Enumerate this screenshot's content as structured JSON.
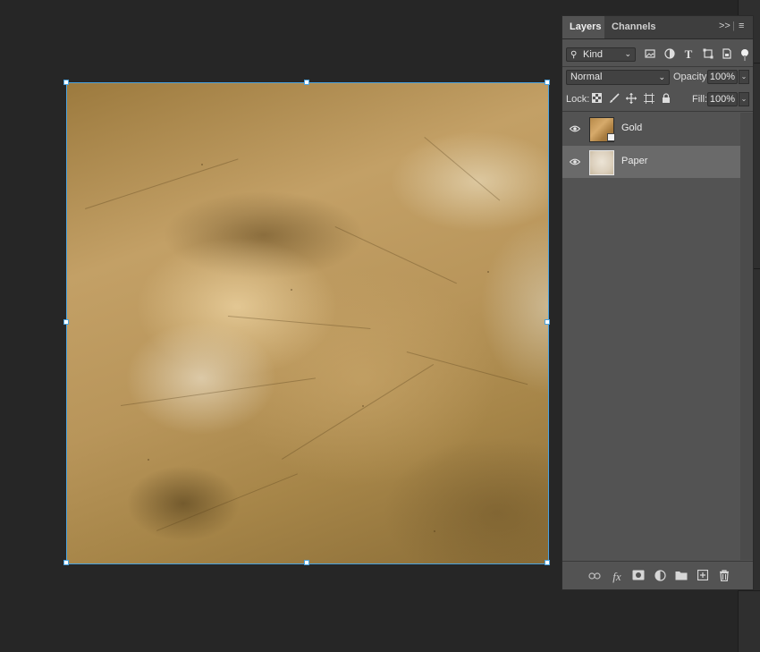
{
  "panel": {
    "tabs": [
      {
        "label": "Layers",
        "active": true
      },
      {
        "label": "Channels",
        "active": false
      }
    ],
    "filter": {
      "kind_label": "Kind",
      "icons": [
        "image-filter-icon",
        "adjustment-filter-icon",
        "type-filter-icon",
        "shape-filter-icon",
        "smart-object-filter-icon",
        "filter-toggle-icon"
      ]
    },
    "blend_mode": "Normal",
    "opacity_label": "Opacity:",
    "opacity_value": "100%",
    "lock_label": "Lock:",
    "fill_label": "Fill:",
    "fill_value": "100%",
    "lock_icons": [
      "lock-transparent-pixels-icon",
      "lock-image-pixels-icon",
      "lock-position-icon",
      "lock-artboard-icon",
      "lock-all-icon"
    ],
    "layers": [
      {
        "name": "Gold",
        "visible": true,
        "selected": false,
        "smart_object": true
      },
      {
        "name": "Paper",
        "visible": true,
        "selected": true,
        "smart_object": false
      }
    ],
    "footer_icons": [
      "link-layers-icon",
      "layer-style-fx-icon",
      "add-mask-icon",
      "adjustment-layer-icon",
      "new-group-icon",
      "new-layer-icon",
      "delete-layer-icon"
    ]
  },
  "colors": {
    "workspace": "#262626",
    "panel": "#535353",
    "selection": "#4aa3e0",
    "selected_row": "#6a6a6a"
  }
}
